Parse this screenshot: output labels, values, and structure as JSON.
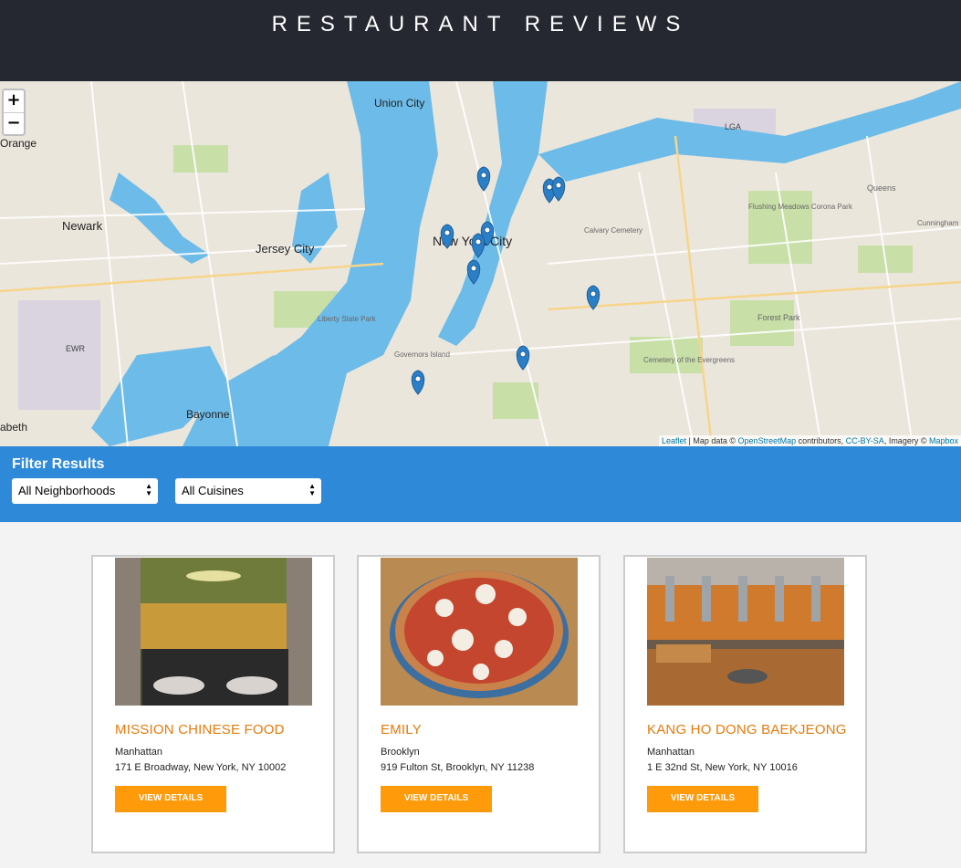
{
  "header": {
    "title": "RESTAURANT REVIEWS"
  },
  "map": {
    "zoom_in": "+",
    "zoom_out": "−",
    "labels": {
      "union_city": "Union City",
      "newark": "Newark",
      "jersey_city": "Jersey City",
      "nyc": "New York City",
      "bayonne": "Bayonne",
      "orange": "Orange",
      "elizabeth": "abeth",
      "queens": "Queens",
      "forest_park": "Forest Park",
      "liberty": "Liberty State Park",
      "governors": "Governors Island",
      "ewr": "EWR",
      "lga": "LGA",
      "calvary": "Calvary Cemetery",
      "flushing": "Flushing Meadows Corona Park",
      "evergreens": "Cemetery of the Evergreens",
      "cunningham": "Cunningham Park"
    },
    "attribution": {
      "leaflet": "Leaflet",
      "text1": " | Map data © ",
      "osm": "OpenStreetMap",
      "text2": " contributors, ",
      "cc": "CC-BY-SA",
      "text3": ", Imagery © ",
      "mapbox": "Mapbox"
    },
    "marker_color": "#2a7fc6"
  },
  "filters": {
    "heading": "Filter Results",
    "neighborhood": "All Neighborhoods",
    "cuisine": "All Cuisines"
  },
  "restaurants": [
    {
      "name": "MISSION CHINESE FOOD",
      "neighborhood": "Manhattan",
      "address": "171 E Broadway, New York, NY 10002",
      "button": "VIEW DETAILS"
    },
    {
      "name": "EMILY",
      "neighborhood": "Brooklyn",
      "address": "919 Fulton St, Brooklyn, NY 11238",
      "button": "VIEW DETAILS"
    },
    {
      "name": "KANG HO DONG BAEKJEONG",
      "neighborhood": "Manhattan",
      "address": "1 E 32nd St, New York, NY 10016",
      "button": "VIEW DETAILS"
    }
  ],
  "colors": {
    "header": "#252831",
    "filter_bar": "#2e8ad8",
    "accent": "#ff9a0a",
    "name": "#e67a0c"
  }
}
